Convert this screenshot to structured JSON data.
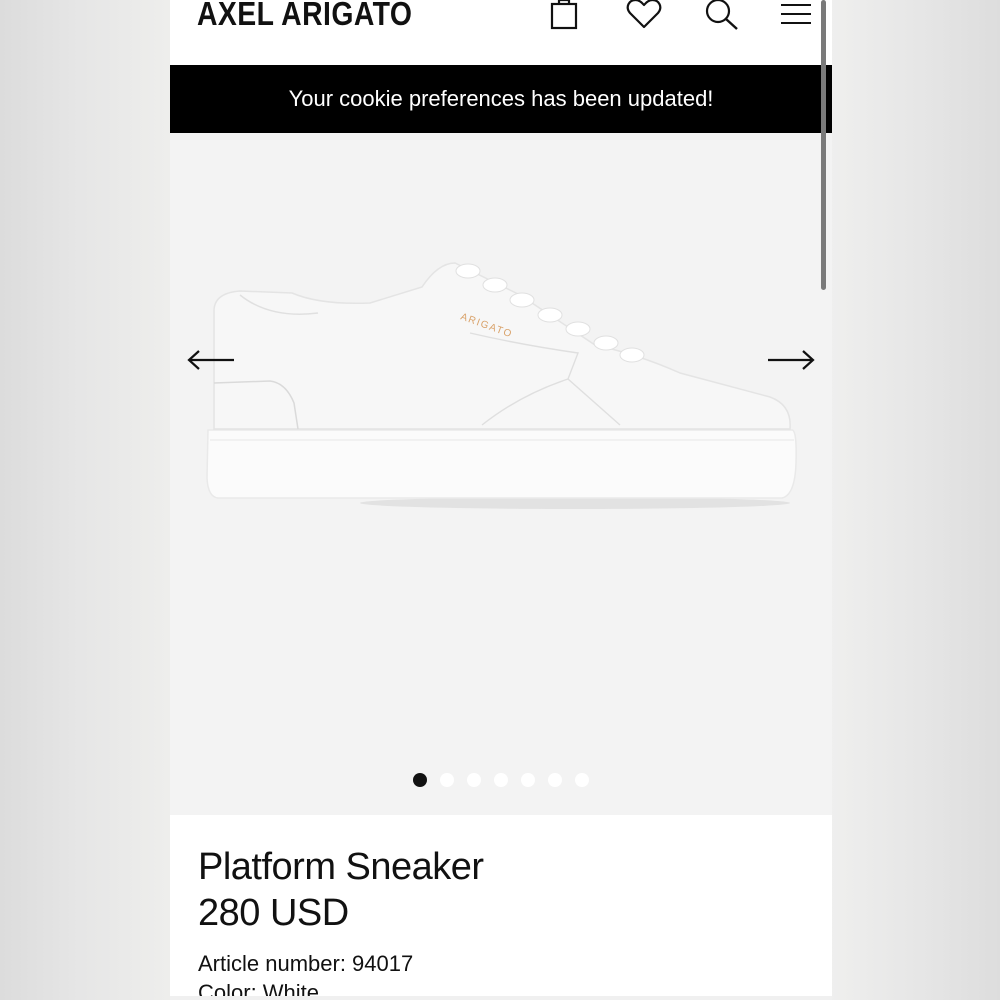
{
  "header": {
    "logo": "AXEL ARIGATO",
    "icons": [
      "bag-icon",
      "heart-icon",
      "search-icon",
      "menu-icon"
    ]
  },
  "banner": {
    "message": "Your cookie preferences has been updated!"
  },
  "gallery": {
    "image": "white-platform-sneaker",
    "shoe_brand_print": "ARIGATO",
    "prev_icon": "arrow-left-icon",
    "next_icon": "arrow-right-icon",
    "dots_total": 7,
    "active_dot": 1
  },
  "product": {
    "name": "Platform Sneaker",
    "price": "280 USD",
    "article": "Article number: 94017",
    "color": "Color: White"
  },
  "colors": {
    "banner_bg": "#000000",
    "gallery_bg": "#f3f3f3",
    "text": "#111111",
    "brand_print": "#d9a26a"
  }
}
